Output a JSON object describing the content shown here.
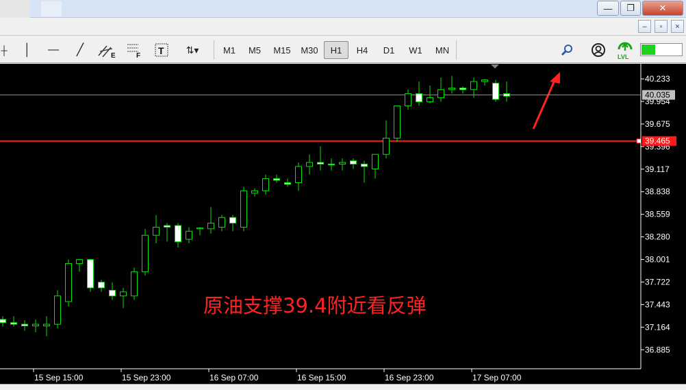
{
  "window": {
    "minimize": "—",
    "restore": "❐",
    "close": "✕"
  },
  "mdi": {
    "minimize": "–",
    "restore": "▫",
    "close": "×"
  },
  "toolbar": {
    "tools": [
      {
        "name": "crosshair-tool",
        "icon": "cursor-cross-icon",
        "glyph": "┼"
      },
      {
        "name": "vertical-line-tool",
        "icon": "vertical-line-icon",
        "glyph": "│"
      },
      {
        "name": "horizontal-line-tool",
        "icon": "horizontal-line-icon",
        "glyph": "—"
      },
      {
        "name": "trendline-tool",
        "icon": "trendline-icon",
        "glyph": "╱"
      },
      {
        "name": "equidistant-channel-tool",
        "icon": "channel-e-icon",
        "glyph": "E"
      },
      {
        "name": "fibonacci-tool",
        "icon": "fibonacci-f-icon",
        "glyph": "F"
      },
      {
        "name": "text-tool",
        "icon": "text-t-icon",
        "glyph": "T"
      },
      {
        "name": "arrows-tool",
        "icon": "arrows-dropdown-icon",
        "glyph": "⇅▾"
      }
    ],
    "timeframes": [
      "M1",
      "M5",
      "M15",
      "M30",
      "H1",
      "H4",
      "D1",
      "W1",
      "MN"
    ],
    "active_timeframe": "H1",
    "right_icons": [
      {
        "name": "search-icon",
        "glyph": "⚲"
      },
      {
        "name": "account-icon",
        "glyph": "◉"
      },
      {
        "name": "level-icon",
        "glyph": "LVL"
      }
    ],
    "signal_fill": 0.35
  },
  "chart_data": {
    "type": "candlestick",
    "y_ticks": [
      40.233,
      39.954,
      39.675,
      39.396,
      39.117,
      38.838,
      38.559,
      38.28,
      38.001,
      37.722,
      37.443,
      37.164,
      36.885
    ],
    "x_ticks": [
      "15 Sep 15:00",
      "15 Sep 23:00",
      "16 Sep 07:00",
      "16 Sep 15:00",
      "16 Sep 23:00",
      "17 Sep 07:00"
    ],
    "ylim": [
      36.65,
      40.42
    ],
    "current_price": "40.035",
    "support_level": 39.465,
    "support_label": "39.465",
    "annotation": "原油支撑39.4附近看反弹",
    "candles": [
      [
        37.26,
        37.3,
        37.17,
        37.22
      ],
      [
        37.22,
        37.3,
        37.17,
        37.2
      ],
      [
        37.2,
        37.25,
        37.12,
        37.18
      ],
      [
        37.18,
        37.26,
        37.1,
        37.2
      ],
      [
        37.18,
        37.3,
        37.05,
        37.2
      ],
      [
        37.2,
        37.62,
        37.15,
        37.55
      ],
      [
        37.48,
        38.0,
        37.42,
        37.95
      ],
      [
        37.95,
        38.01,
        37.85,
        38.0
      ],
      [
        38.0,
        38.01,
        37.6,
        37.65
      ],
      [
        37.72,
        37.75,
        37.6,
        37.65
      ],
      [
        37.62,
        37.72,
        37.5,
        37.55
      ],
      [
        37.55,
        37.65,
        37.4,
        37.6
      ],
      [
        37.55,
        37.9,
        37.5,
        37.85
      ],
      [
        37.85,
        38.38,
        37.8,
        38.3
      ],
      [
        38.3,
        38.55,
        38.2,
        38.4
      ],
      [
        38.42,
        38.45,
        38.22,
        38.4
      ],
      [
        38.42,
        38.45,
        38.15,
        38.22
      ],
      [
        38.25,
        38.4,
        38.2,
        38.35
      ],
      [
        38.38,
        38.4,
        38.3,
        38.39
      ],
      [
        38.38,
        38.65,
        38.32,
        38.45
      ],
      [
        38.4,
        38.55,
        38.35,
        38.52
      ],
      [
        38.52,
        38.55,
        38.35,
        38.45
      ],
      [
        38.4,
        38.9,
        38.35,
        38.85
      ],
      [
        38.82,
        38.88,
        38.78,
        38.85
      ],
      [
        38.85,
        39.05,
        38.8,
        39.0
      ],
      [
        39.0,
        39.05,
        38.95,
        38.98
      ],
      [
        38.95,
        39.0,
        38.9,
        38.93
      ],
      [
        38.95,
        39.2,
        38.85,
        39.15
      ],
      [
        39.15,
        39.3,
        39.05,
        39.2
      ],
      [
        39.2,
        39.4,
        39.1,
        39.18
      ],
      [
        39.18,
        39.25,
        39.1,
        39.17
      ],
      [
        39.18,
        39.25,
        39.1,
        39.2
      ],
      [
        39.22,
        39.25,
        39.12,
        39.18
      ],
      [
        39.18,
        39.22,
        38.95,
        39.15
      ],
      [
        39.12,
        39.22,
        39.0,
        39.3
      ],
      [
        39.3,
        39.72,
        39.25,
        39.5
      ],
      [
        39.5,
        39.75,
        39.45,
        39.9
      ],
      [
        39.9,
        40.1,
        39.85,
        40.05
      ],
      [
        40.05,
        40.2,
        39.9,
        39.95
      ],
      [
        39.95,
        40.15,
        39.93,
        40.0
      ],
      [
        40.0,
        40.25,
        39.95,
        40.1
      ],
      [
        40.1,
        40.27,
        40.05,
        40.12
      ],
      [
        40.12,
        40.14,
        40.05,
        40.1
      ],
      [
        40.1,
        40.25,
        40.0,
        40.2
      ],
      [
        40.2,
        40.23,
        40.15,
        40.22
      ],
      [
        40.18,
        40.22,
        39.95,
        39.98
      ],
      [
        40.05,
        40.2,
        39.95,
        40.02
      ]
    ]
  }
}
